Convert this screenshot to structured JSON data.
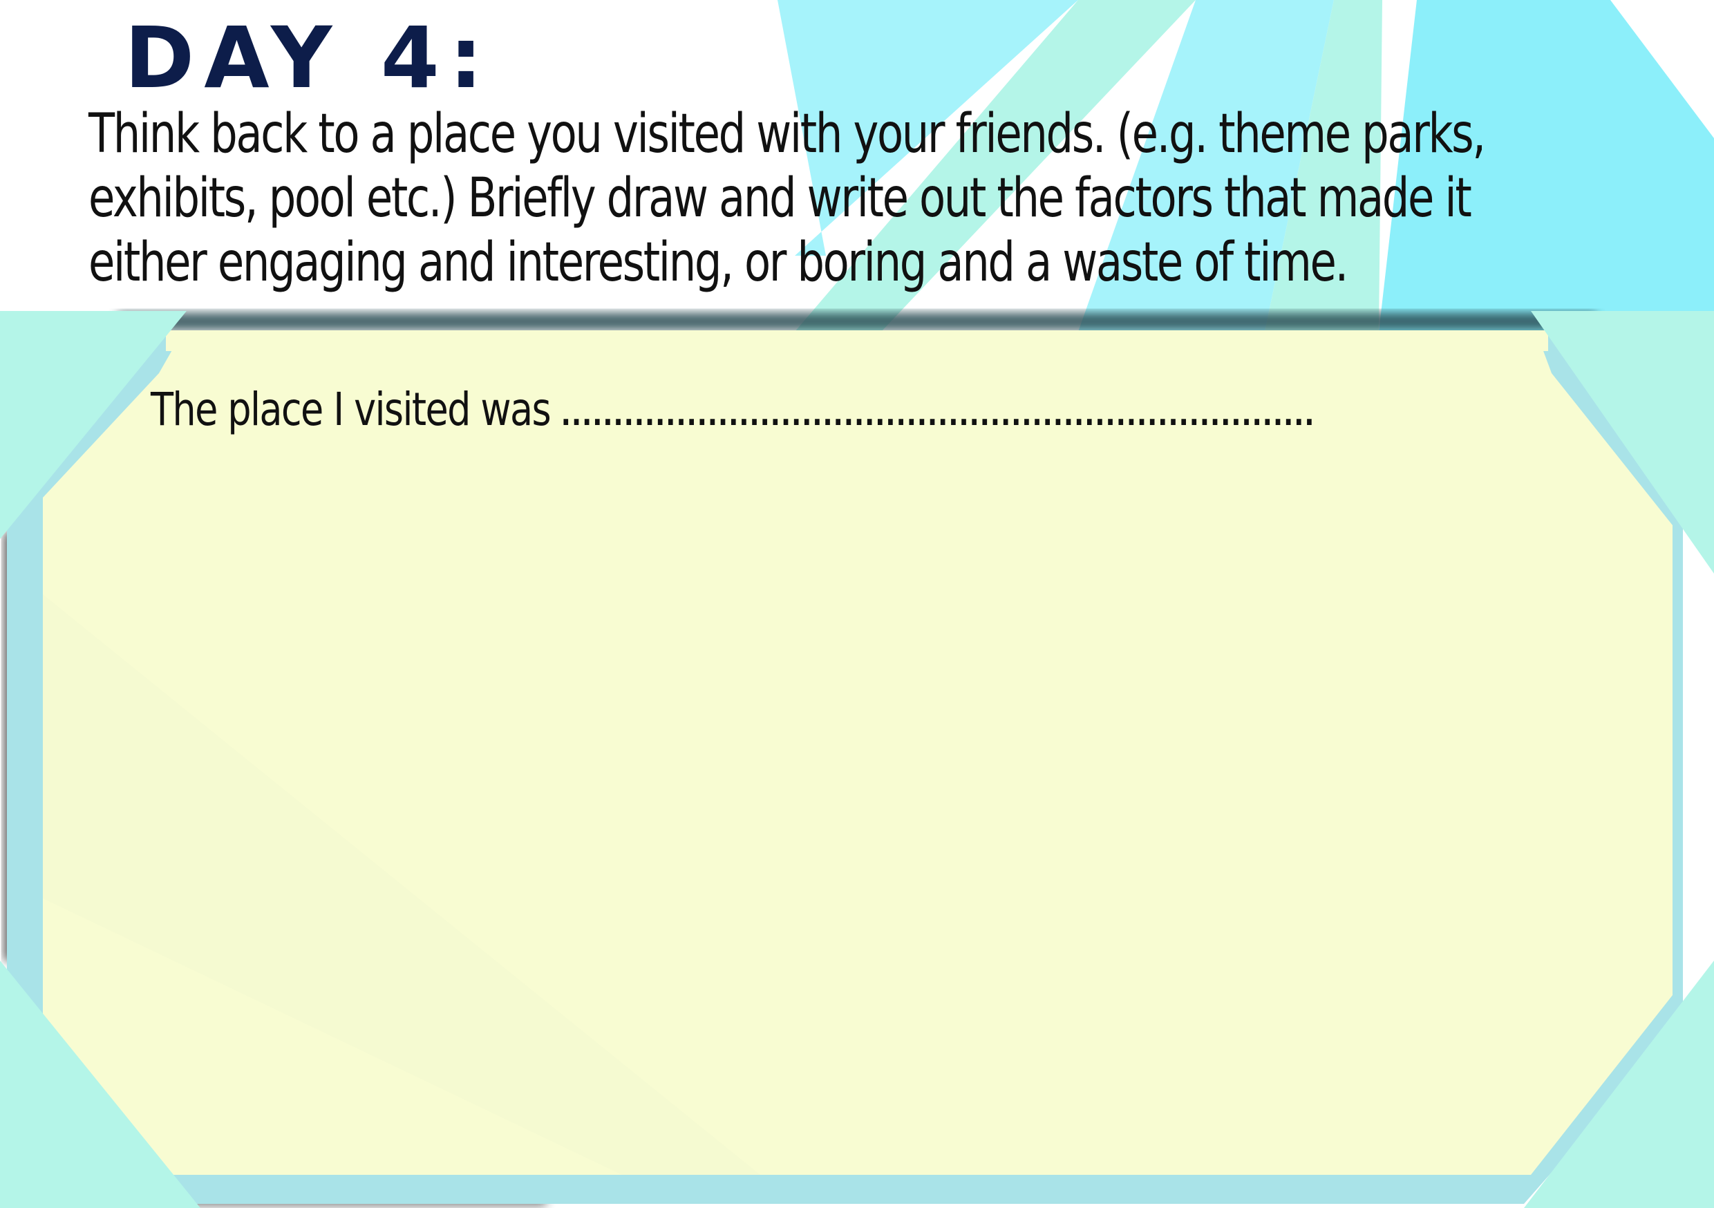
{
  "worksheet": {
    "title": "DAY 4:",
    "instructions": [
      "Think back to a place you visited with your friends. (e.g. theme parks,",
      "exhibits, pool etc.) Briefly draw and write out the factors that made it",
      "either engaging and interesting, or boring and a waste of time."
    ],
    "prompt": {
      "label": "The place I visited was",
      "fill_line": "........................................................................"
    }
  },
  "colors": {
    "title": "#0d1d4a",
    "text": "#111111",
    "panel_fill": "#f8fcd2",
    "panel_stripe": "#a9e3e8",
    "mint": "#b4f5e8",
    "cyan_light": "#a6f3fb",
    "cyan": "#8ceffa",
    "background": "#ffffff"
  }
}
